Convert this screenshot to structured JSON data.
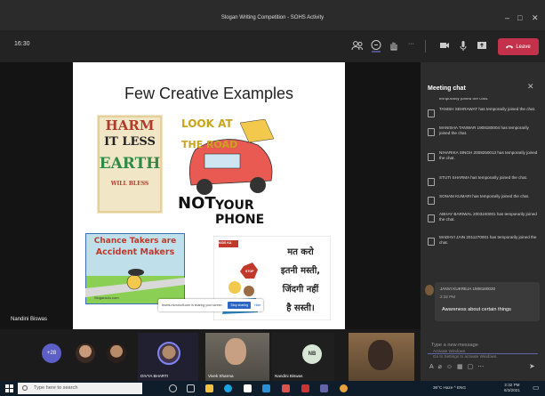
{
  "window": {
    "title": "Slogan Writing Competition - SOHS Activity",
    "minimize": "–",
    "maximize": "□",
    "close": "✕"
  },
  "toolbar": {
    "timer": "16:30",
    "more_label": "···",
    "leave_label": "Leave"
  },
  "stage": {
    "slide_title": "Few Creative Examples",
    "posters": {
      "harm_earth": [
        "HARM",
        "IT LESS",
        "EARTH",
        "WILL BLESS"
      ],
      "look_road": [
        "LOOK AT",
        "THE ROAD",
        "NOT",
        "YOUR PHONE"
      ],
      "chance_takers": [
        "Chance Takers are",
        "Accident Makers"
      ],
      "chance_takers_footer": "Slogans4u.com",
      "hindi": [
        "मत करो",
        "इतनी मस्ती,",
        "जिंदगी नहीं",
        "है सस्ती।"
      ],
      "hindi_stop": "STOP",
      "hindi_brand": "KIDS KA"
    },
    "presenter_label": "Nandini Biswas",
    "share_banner": {
      "text": "teams.microsoft.com is sharing your screen.",
      "stop": "Stop sharing",
      "hide": "Hide"
    }
  },
  "chat": {
    "header": "Meeting chat",
    "close_label": "✕",
    "messages": [
      "temporarily joined the chat.",
      "TANISH SEHRAWAT has temporarily joined the chat.",
      "MANISHA TANWAR 1908180004 has temporarily joined the chat.",
      "NIHARIKA SINGH 2008250013 has temporarily joined the chat.",
      "STUTI SHARMA has temporarily joined the chat.",
      "SONAM KUMARI has temporarily joined the chat.",
      "ABHAY BARIWAL 2003240001 has temporarily joined the chat.",
      "MADHVI JAIN 2011270001 has temporarily joined the chat."
    ],
    "last_message": {
      "author": "JANVI KUKREJA 1908180020",
      "time": "2:32 PM",
      "text": "Awareness about certain things"
    },
    "compose_placeholder": "Type a new message",
    "watermark": [
      "Activate Windows",
      "Go to Settings to activate Windows."
    ]
  },
  "participants": {
    "overflow_count": "+28",
    "tiles": [
      {
        "name": "DIVYA BHARTI"
      },
      {
        "name": "Vivek Sharma"
      },
      {
        "name": "Nandini Biswas"
      }
    ],
    "nb_initials": "NB"
  },
  "taskbar": {
    "search_placeholder": "Type here to search",
    "weather": "36°C  Haze",
    "lang": "ENG",
    "time": "2:32 PM",
    "date": "6/3/2021"
  },
  "colors": {
    "accent": "#6264a7",
    "leave": "#c4314b",
    "stop_share": "#2b66c4"
  }
}
